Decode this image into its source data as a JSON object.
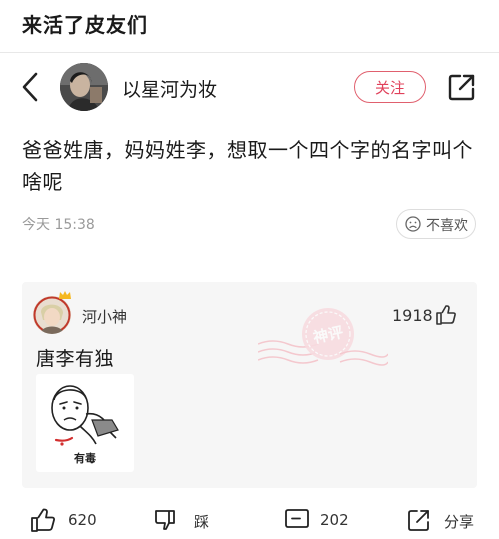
{
  "banner": {
    "title": "来活了皮友们"
  },
  "header": {
    "username": "以星河为妆",
    "follow_label": "关注"
  },
  "post": {
    "text": "爸爸姓唐，妈妈姓李，想取一个四个字的名字叫个啥呢",
    "time": "今天 15:38",
    "dislike_label": "不喜欢"
  },
  "comment": {
    "author": "河小神",
    "likes": "1918",
    "text": "唐李有独",
    "stamp_text": "神评",
    "sticker_caption": "有毒"
  },
  "actions": {
    "like_count": "620",
    "dislike_label": "踩",
    "comment_count": "202",
    "share_label": "分享"
  },
  "colors": {
    "accent": "#e0405a",
    "stamp": "#f08a98"
  }
}
